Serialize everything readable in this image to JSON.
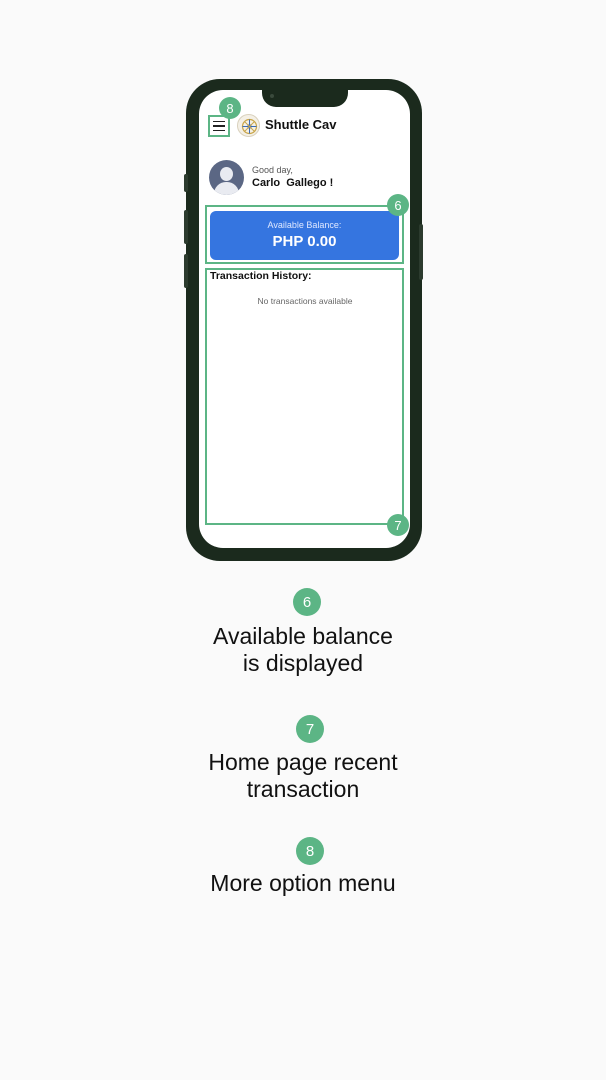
{
  "app": {
    "title": "Shuttle Cav",
    "logo_icon": "shuttle-cav-logo"
  },
  "header": {
    "menu_icon": "hamburger-menu-icon"
  },
  "user": {
    "greeting": "Good day,",
    "name": "Carlo  Gallego !"
  },
  "balance": {
    "label": "Available Balance:",
    "value": "PHP 0.00"
  },
  "transactions": {
    "title": "Transaction History:",
    "empty_message": "No transactions available"
  },
  "annotations": [
    {
      "number": "6",
      "text": "Available balance is displayed"
    },
    {
      "number": "7",
      "text": "Home page recent transaction"
    },
    {
      "number": "8",
      "text": "More option menu"
    }
  ],
  "colors": {
    "accent_green": "#5cb585",
    "balance_blue": "#3575e0",
    "phone_frame": "#1b2a1d"
  }
}
